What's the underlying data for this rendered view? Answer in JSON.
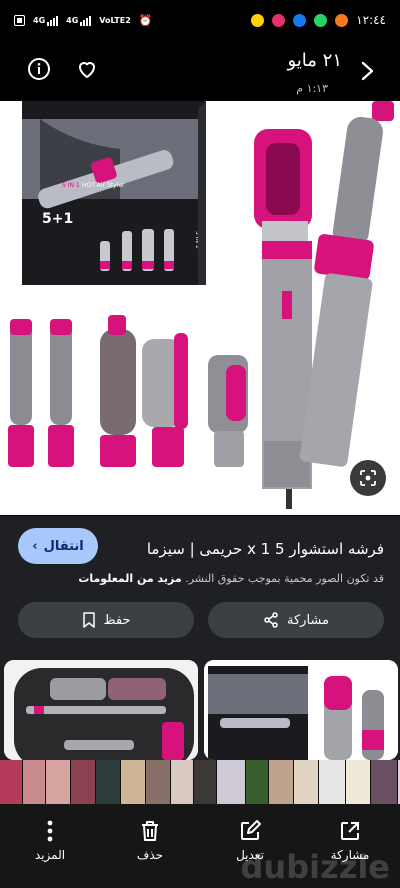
{
  "status_bar": {
    "time": "١٢:٤٤",
    "network_1": "4G",
    "network_2": "4G",
    "network_3": "VoLTE2"
  },
  "header": {
    "date_title": "٢١ مايو",
    "time_sub": "١:١٣ م"
  },
  "main_image": {
    "box_badge": "5 IN 1",
    "box_text": "HOT Air Styler",
    "box_side": "5 IN 1",
    "box_tag": "5+1"
  },
  "info": {
    "title": "فرشه استشوار 5 x 1 حريمى | سيزما",
    "visit_label": "انتقال",
    "copyright_notice": "قد تكون الصور محمية بموجب حقوق النشر.",
    "more_info": "مزيد من المعلومات",
    "share_label": "مشاركة",
    "save_label": "حفظ"
  },
  "bottom_nav": {
    "share": "مشاركة",
    "edit": "تعديل",
    "delete": "حذف",
    "more": "المزيد"
  },
  "watermark": "dubizzle",
  "colors": {
    "magenta": "#d6137c",
    "silver": "#9a9a9e",
    "accent_button": "#a8c7fa"
  }
}
